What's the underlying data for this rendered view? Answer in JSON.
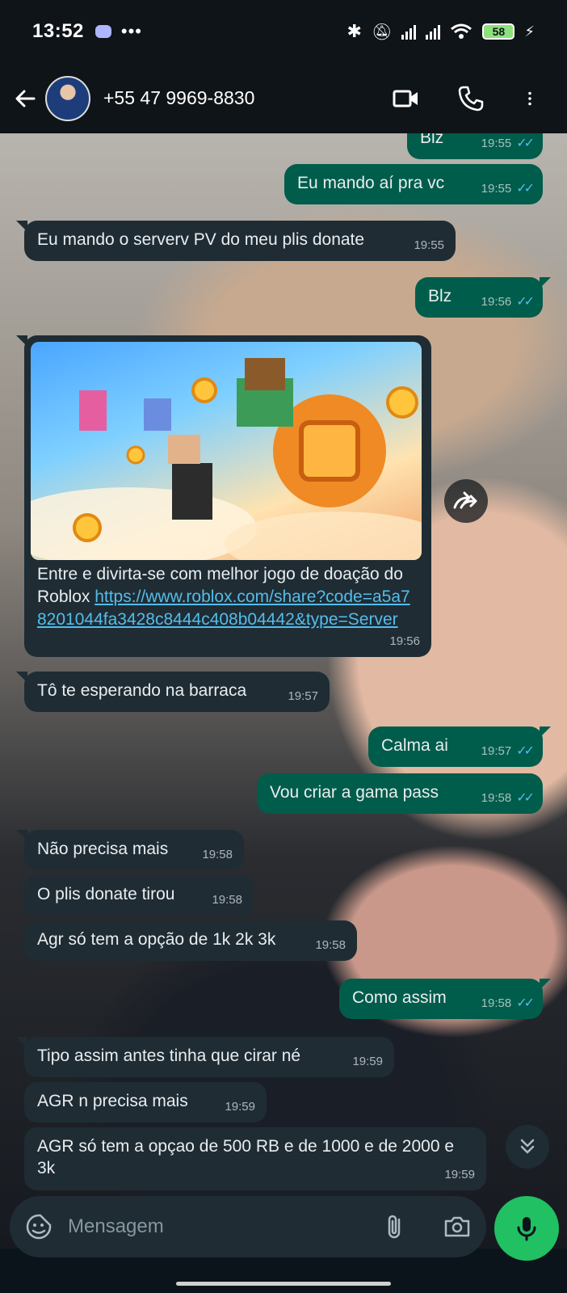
{
  "status_bar": {
    "time": "13:52",
    "battery": "58"
  },
  "header": {
    "contact_name": "+55 47 9969-8830"
  },
  "messages": [
    {
      "dir": "out",
      "text": "Blz",
      "time": "19:55"
    },
    {
      "dir": "out",
      "text": "Eu mando aí pra vc",
      "time": "19:55"
    },
    {
      "dir": "in",
      "text": "Eu mando o serverv PV do meu plis donate",
      "time": "19:55"
    },
    {
      "dir": "out",
      "text": "Blz",
      "time": "19:56"
    },
    {
      "dir": "in",
      "text_prefix": "Entre e divirta-se com melhor jogo de doação do Roblox ",
      "link": "https://www.roblox.com/share?code=a5a78201044fa3428c8444c408b04442&type=Server",
      "time": "19:56"
    },
    {
      "dir": "in",
      "text": "Tô te esperando na barraca",
      "time": "19:57"
    },
    {
      "dir": "out",
      "text": "Calma ai",
      "time": "19:57"
    },
    {
      "dir": "out",
      "text": "Vou criar a gama pass",
      "time": "19:58"
    },
    {
      "dir": "in",
      "text": "Não precisa mais",
      "time": "19:58"
    },
    {
      "dir": "in",
      "text": "O plis donate tirou",
      "time": "19:58"
    },
    {
      "dir": "in",
      "text": "Agr só tem a opção de 1k 2k 3k",
      "time": "19:58"
    },
    {
      "dir": "out",
      "text": "Como assim",
      "time": "19:58"
    },
    {
      "dir": "in",
      "text": "Tipo assim antes tinha que cirar né",
      "time": "19:59"
    },
    {
      "dir": "in",
      "text": "AGR n precisa mais",
      "time": "19:59"
    },
    {
      "dir": "in",
      "text": "AGR só tem a opçao de 500 RB e de 1000 e de 2000 e 3k",
      "time": "19:59"
    }
  ],
  "composer": {
    "placeholder": "Mensagem"
  },
  "colors": {
    "incoming": "#1f2c34",
    "outgoing": "#005c4b",
    "accent": "#21c063",
    "link": "#53bdeb"
  },
  "icons": [
    "back-arrow-icon",
    "video-call-icon",
    "phone-icon",
    "more-vert-icon",
    "forward-icon",
    "scroll-down-icon",
    "sticker-icon",
    "attach-icon",
    "camera-icon",
    "mic-icon"
  ]
}
